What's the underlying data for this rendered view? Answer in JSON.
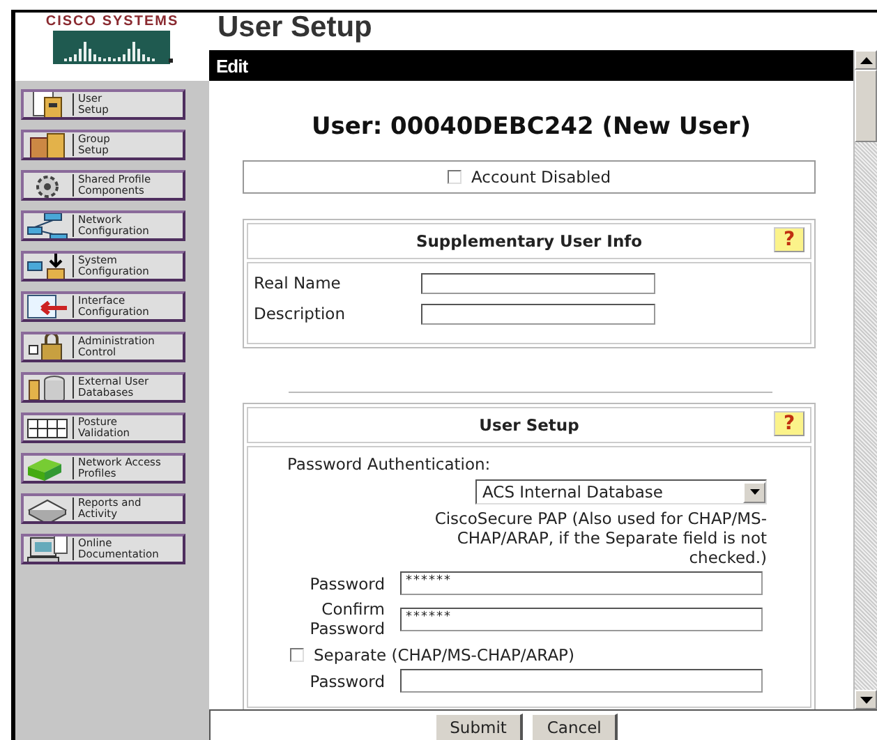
{
  "logo": {
    "text": "CISCO SYSTEMS"
  },
  "nav": [
    {
      "lines": [
        "User",
        "Setup"
      ],
      "selected": false
    },
    {
      "lines": [
        "Group",
        "Setup"
      ],
      "selected": false
    },
    {
      "lines": [
        "Shared Profile",
        "Components"
      ],
      "selected": false
    },
    {
      "lines": [
        "Network",
        "Configuration"
      ],
      "selected": false
    },
    {
      "lines": [
        "System",
        "Configuration"
      ],
      "selected": false
    },
    {
      "lines": [
        "Interface",
        "Configuration"
      ],
      "selected": false
    },
    {
      "lines": [
        "Administration",
        "Control"
      ],
      "selected": false
    },
    {
      "lines": [
        "External User",
        "Databases"
      ],
      "selected": false
    },
    {
      "lines": [
        "Posture",
        "Validation"
      ],
      "selected": false
    },
    {
      "lines": [
        "Network Access",
        "Profiles"
      ],
      "selected": false
    },
    {
      "lines": [
        "Reports and",
        "Activity"
      ],
      "selected": false
    },
    {
      "lines": [
        "Online",
        "Documentation"
      ],
      "selected": false
    }
  ],
  "page_title": "User Setup",
  "edit_bar": "Edit",
  "heading": "User: 00040DEBC242 (New User)",
  "account_disabled": {
    "label": "Account Disabled",
    "checked": false
  },
  "supplementary": {
    "title": "Supplementary User Info",
    "help": "?",
    "fields": [
      {
        "label": "Real Name"
      },
      {
        "label": "Description"
      }
    ]
  },
  "user_setup": {
    "title": "User Setup",
    "help": "?",
    "auth_label": "Password Authentication:",
    "auth_select": "ACS Internal Database",
    "note": "CiscoSecure PAP (Also used for CHAP/MS-CHAP/ARAP, if the Separate field is not checked.)",
    "fields": [
      {
        "label": "Password",
        "value": "******"
      },
      {
        "label": "Confirm Password",
        "value": "******"
      }
    ],
    "separate": {
      "label": "Separate (CHAP/MS-CHAP/ARAP)",
      "checked": false
    },
    "separate_fields": [
      {
        "label": "Password"
      }
    ]
  },
  "buttons": [
    "Submit",
    "Cancel"
  ]
}
